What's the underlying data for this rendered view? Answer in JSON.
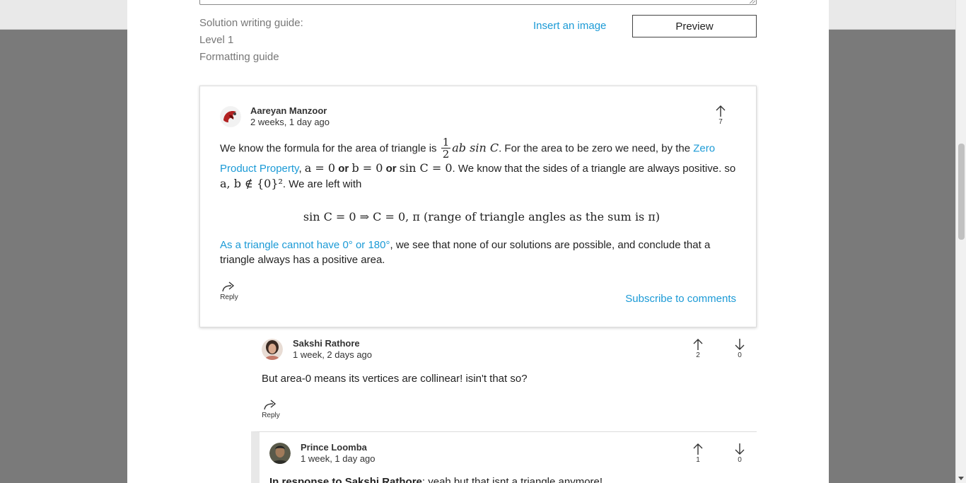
{
  "editor": {
    "guide_title": "Solution writing guide:",
    "guide_level": "Level 1",
    "guide_format": "Formatting guide",
    "insert_image": "Insert an image",
    "preview": "Preview"
  },
  "comment": {
    "author": "Aareyan Manzoor",
    "date": "2 weeks, 1 day ago",
    "upvotes": "7",
    "p1": {
      "a": "We know the formula for the area of triangle is ",
      "frac_num": "1",
      "frac_den": "2",
      "m_area": "ab sin C",
      "b": ". For the area to be zero we need, by the ",
      "link": "Zero Product Property",
      "c": ", ",
      "m_a": "a = 0",
      "or1": " or ",
      "m_b": "b = 0",
      "or2": " or ",
      "m_sin": "sin C = 0",
      "d": ". We know that the sides of a triangle are always positive. so ",
      "m_set": "a, b ∉ {0}²",
      "e": ". We are left with"
    },
    "display_math": "sin C = 0  ⇒  C = 0,  π (range of triangle angles as the sum is π)",
    "p2": {
      "link": "As a triangle cannot have 0° or 180°",
      "rest": ", we see that none of our solutions are possible, and conclude that a triangle always has a positive area."
    },
    "reply": "Reply",
    "subscribe": "Subscribe to comments"
  },
  "reply1": {
    "author": "Sakshi Rathore",
    "date": "1 week, 2 days ago",
    "upvotes": "2",
    "downvotes": "0",
    "text": "But area-0 means its vertices are collinear! isin't that so?",
    "reply": "Reply"
  },
  "reply2": {
    "author": "Prince Loomba",
    "date": "1 week, 1 day ago",
    "upvotes": "1",
    "downvotes": "0",
    "prefix": "In response to ",
    "mention": "Sakshi Rathore",
    "text": ": yeah but that isnt a triangle anymore!"
  },
  "colors": {
    "accent": "#1b9ad6",
    "backdrop": "#7a7a7a"
  }
}
